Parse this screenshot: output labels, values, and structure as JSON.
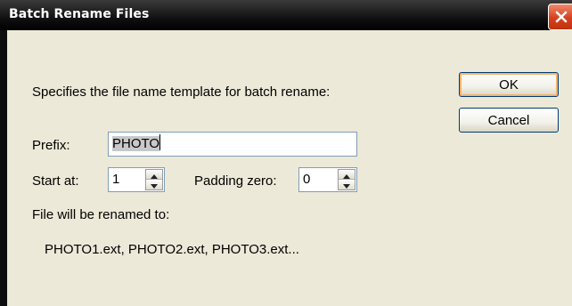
{
  "window": {
    "title": "Batch Rename Files"
  },
  "dialog": {
    "description": "Specifies the file name template for batch rename:",
    "prefix_label": "Prefix:",
    "prefix_value": "PHOTO",
    "start_label": "Start at:",
    "start_value": "1",
    "padding_label": "Padding zero:",
    "padding_value": "0",
    "preview_label": "File will be renamed to:",
    "preview_value": "PHOTO1.ext, PHOTO2.ext, PHOTO3.ext..."
  },
  "buttons": {
    "ok": "OK",
    "cancel": "Cancel"
  },
  "icons": {
    "close": "close-icon",
    "spin_up": "arrow-up-icon",
    "spin_down": "arrow-down-icon"
  },
  "colors": {
    "titlebar": "#111111",
    "close_button": "#d5401f",
    "dialog_background": "#ece9d8",
    "default_button_highlight": "#f5b26a"
  }
}
